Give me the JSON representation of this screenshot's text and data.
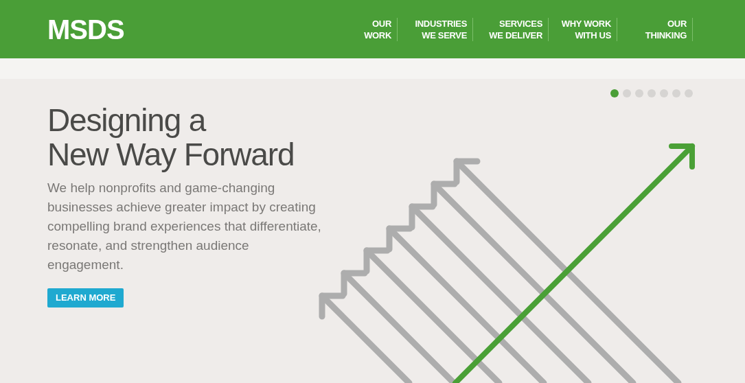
{
  "header": {
    "logo": "MSDS",
    "nav": [
      {
        "lines": [
          "OUR",
          "WORK"
        ]
      },
      {
        "lines": [
          "INDUSTRIES",
          "WE SERVE"
        ]
      },
      {
        "lines": [
          "SERVICES",
          "WE DELIVER"
        ]
      },
      {
        "lines": [
          "WHY WORK",
          "WITH US"
        ]
      },
      {
        "lines": [
          "OUR",
          "THINKING"
        ]
      }
    ]
  },
  "hero": {
    "heading_lines": [
      "Designing a",
      "New Way Forward"
    ],
    "text": "We help nonprofits and game-changing businesses achieve greater impact by creating compelling brand experiences that differentiate, resonate, and strengthen audience engagement.",
    "button": "LEARN MORE",
    "slides": [
      {
        "selected": true
      },
      {
        "selected": false
      },
      {
        "selected": false
      },
      {
        "selected": false
      },
      {
        "selected": false
      },
      {
        "selected": false
      },
      {
        "selected": false
      }
    ]
  }
}
